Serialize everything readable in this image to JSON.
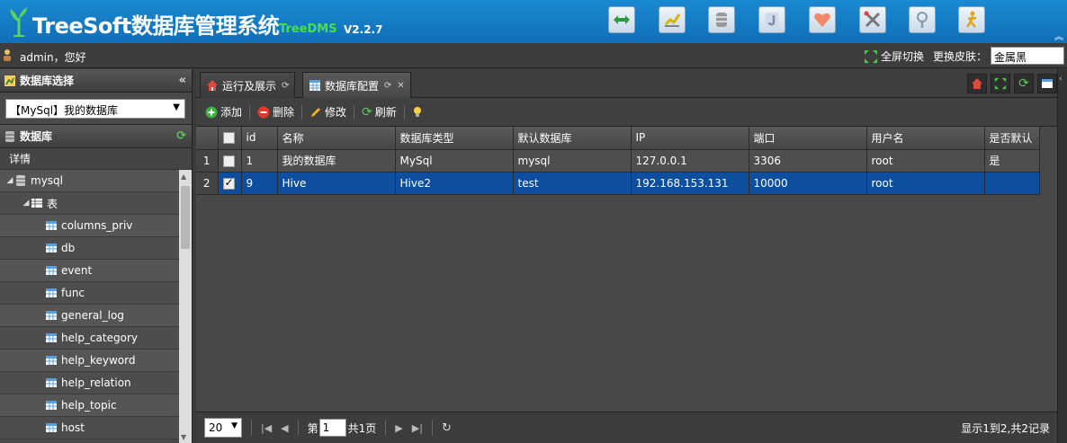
{
  "header": {
    "title": "TreeSoft数据库管理系统",
    "subtitle": "TreeDMS",
    "version": "V2.2.7",
    "tools": [
      {
        "icon": "swap-arrows-icon"
      },
      {
        "icon": "chart-icon"
      },
      {
        "icon": "database-icon"
      },
      {
        "icon": "j-letter-icon"
      },
      {
        "icon": "heart-icon"
      },
      {
        "icon": "tools-icon"
      },
      {
        "icon": "help-icon"
      },
      {
        "icon": "user-run-icon"
      }
    ]
  },
  "userbar": {
    "greeting": "admin，您好",
    "fullscreen_label": "全屏切换",
    "skin_label": "更换皮肤：",
    "skin_value": "金属黑"
  },
  "left": {
    "db_select_title": "数据库选择",
    "db_select_value": "【MySql】我的数据库",
    "db_tree_title": "数据库",
    "detail_label": "详情",
    "tree": [
      {
        "label": "mysql",
        "level": 0,
        "type": "db"
      },
      {
        "label": "表",
        "level": 1,
        "type": "folder"
      },
      {
        "label": "columns_priv",
        "level": 2,
        "type": "table"
      },
      {
        "label": "db",
        "level": 2,
        "type": "table"
      },
      {
        "label": "event",
        "level": 2,
        "type": "table"
      },
      {
        "label": "func",
        "level": 2,
        "type": "table"
      },
      {
        "label": "general_log",
        "level": 2,
        "type": "table"
      },
      {
        "label": "help_category",
        "level": 2,
        "type": "table"
      },
      {
        "label": "help_keyword",
        "level": 2,
        "type": "table"
      },
      {
        "label": "help_relation",
        "level": 2,
        "type": "table"
      },
      {
        "label": "help_topic",
        "level": 2,
        "type": "table"
      },
      {
        "label": "host",
        "level": 2,
        "type": "table"
      }
    ]
  },
  "tabs": [
    {
      "label": "运行及展示",
      "active": false
    },
    {
      "label": "数据库配置",
      "active": true
    }
  ],
  "toolbar": {
    "add": "添加",
    "delete": "删除",
    "edit": "修改",
    "refresh": "刷新"
  },
  "grid": {
    "columns": [
      "id",
      "名称",
      "数据库类型",
      "默认数据库",
      "IP",
      "端口",
      "用户名",
      "是否默认"
    ],
    "rows": [
      {
        "num": "1",
        "checked": false,
        "selected": false,
        "cells": [
          "1",
          "我的数据库",
          "MySql",
          "mysql",
          "127.0.0.1",
          "3306",
          "root",
          "是"
        ]
      },
      {
        "num": "2",
        "checked": true,
        "selected": true,
        "cells": [
          "9",
          "Hive",
          "Hive2",
          "test",
          "192.168.153.131",
          "10000",
          "root",
          ""
        ]
      }
    ]
  },
  "pager": {
    "page_size": "20",
    "page_prefix": "第",
    "page_value": "1",
    "page_suffix": "共1页",
    "info": "显示1到2,共2记录"
  },
  "colors": {
    "header_blue": "#1680c8",
    "selected_row": "#0d4f9e",
    "subtitle_green": "#46e04a"
  }
}
